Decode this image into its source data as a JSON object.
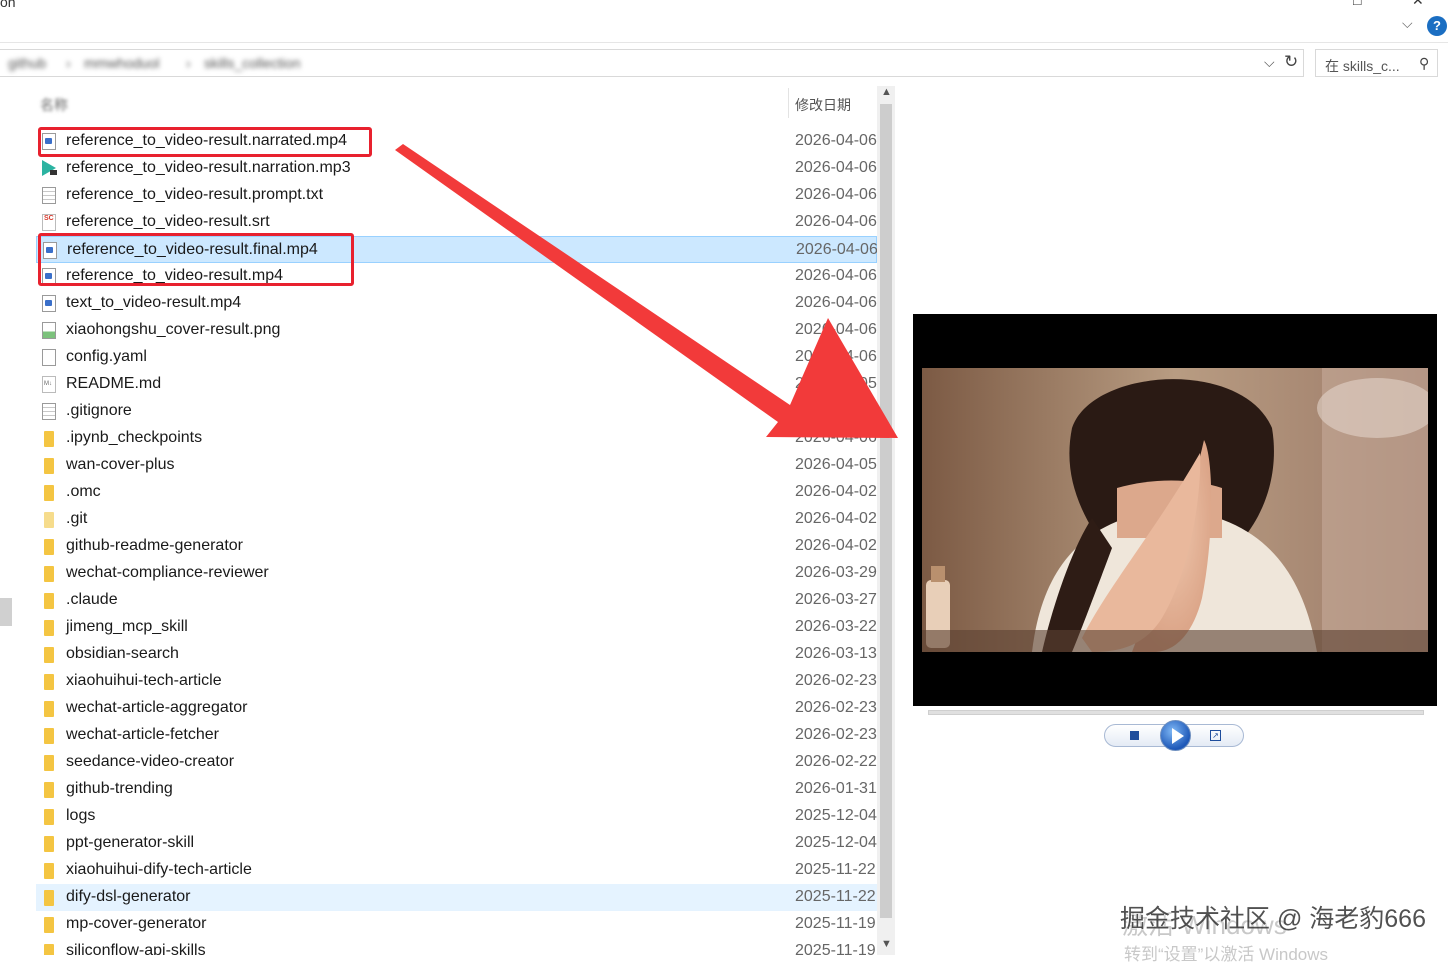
{
  "window": {
    "title_fragment": "on"
  },
  "address": {
    "crumbs": [
      "github",
      "mmwhoduol",
      "skills_collection"
    ]
  },
  "search": {
    "placeholder": "在 skills_c..."
  },
  "columns": {
    "name": "名称",
    "date": "修改日期"
  },
  "files": [
    {
      "name": "reference_to_video-result.narrated.mp4",
      "date": "2026-04-06",
      "icon": "video-file-icon",
      "state": ""
    },
    {
      "name": "reference_to_video-result.narration.mp3",
      "date": "2026-04-06",
      "icon": "audio-file-icon",
      "state": ""
    },
    {
      "name": "reference_to_video-result.prompt.txt",
      "date": "2026-04-06",
      "icon": "text-file-icon",
      "state": ""
    },
    {
      "name": "reference_to_video-result.srt",
      "date": "2026-04-06",
      "icon": "subtitle-file-icon",
      "state": ""
    },
    {
      "name": "reference_to_video-result.final.mp4",
      "date": "2026-04-06",
      "icon": "video-file-icon",
      "state": "selected"
    },
    {
      "name": "reference_to_video-result.mp4",
      "date": "2026-04-06",
      "icon": "video-file-icon",
      "state": ""
    },
    {
      "name": "text_to_video-result.mp4",
      "date": "2026-04-06",
      "icon": "video-file-icon",
      "state": ""
    },
    {
      "name": "xiaohongshu_cover-result.png",
      "date": "2026-04-06",
      "icon": "image-file-icon",
      "state": ""
    },
    {
      "name": "config.yaml",
      "date": "2026-04-06",
      "icon": "blank-file-icon",
      "state": ""
    },
    {
      "name": "README.md",
      "date": "2026-04-05",
      "icon": "markdown-file-icon",
      "state": ""
    },
    {
      "name": ".gitignore",
      "date": "2026-04-05",
      "icon": "text-file-icon",
      "state": ""
    },
    {
      "name": ".ipynb_checkpoints",
      "date": "2026-04-06",
      "icon": "folder-icon",
      "state": ""
    },
    {
      "name": "wan-cover-plus",
      "date": "2026-04-05",
      "icon": "folder-icon",
      "state": ""
    },
    {
      "name": ".omc",
      "date": "2026-04-02",
      "icon": "folder-icon",
      "state": ""
    },
    {
      "name": ".git",
      "date": "2026-04-02",
      "icon": "folder-faint-icon",
      "state": ""
    },
    {
      "name": "github-readme-generator",
      "date": "2026-04-02",
      "icon": "folder-icon",
      "state": ""
    },
    {
      "name": "wechat-compliance-reviewer",
      "date": "2026-03-29",
      "icon": "folder-icon",
      "state": ""
    },
    {
      "name": ".claude",
      "date": "2026-03-27",
      "icon": "folder-icon",
      "state": ""
    },
    {
      "name": "jimeng_mcp_skill",
      "date": "2026-03-22",
      "icon": "folder-icon",
      "state": ""
    },
    {
      "name": "obsidian-search",
      "date": "2026-03-13",
      "icon": "folder-icon",
      "state": ""
    },
    {
      "name": "xiaohuihui-tech-article",
      "date": "2026-02-23",
      "icon": "folder-icon",
      "state": ""
    },
    {
      "name": "wechat-article-aggregator",
      "date": "2026-02-23",
      "icon": "folder-icon",
      "state": ""
    },
    {
      "name": "wechat-article-fetcher",
      "date": "2026-02-23",
      "icon": "folder-icon",
      "state": ""
    },
    {
      "name": "seedance-video-creator",
      "date": "2026-02-22",
      "icon": "folder-icon",
      "state": ""
    },
    {
      "name": "github-trending",
      "date": "2026-01-31",
      "icon": "folder-icon",
      "state": ""
    },
    {
      "name": "logs",
      "date": "2025-12-04",
      "icon": "folder-icon",
      "state": ""
    },
    {
      "name": "ppt-generator-skill",
      "date": "2025-12-04",
      "icon": "folder-icon",
      "state": ""
    },
    {
      "name": "xiaohuihui-dify-tech-article",
      "date": "2025-11-22",
      "icon": "folder-icon",
      "state": ""
    },
    {
      "name": "dify-dsl-generator",
      "date": "2025-11-22",
      "icon": "folder-icon",
      "state": "hover"
    },
    {
      "name": "mp-cover-generator",
      "date": "2025-11-19",
      "icon": "folder-icon",
      "state": ""
    },
    {
      "name": "siliconflow-api-skills",
      "date": "2025-11-19",
      "icon": "folder-icon",
      "state": ""
    }
  ],
  "watermark": {
    "activate_title": "激活 Windows",
    "activate_hint": "转到“设置”以激活 Windows",
    "credit": "掘金技术社区 @ 海老豹666"
  },
  "colors": {
    "annotation": "#e8212e",
    "selection": "#cce8ff",
    "accent": "#1b6ec2"
  }
}
